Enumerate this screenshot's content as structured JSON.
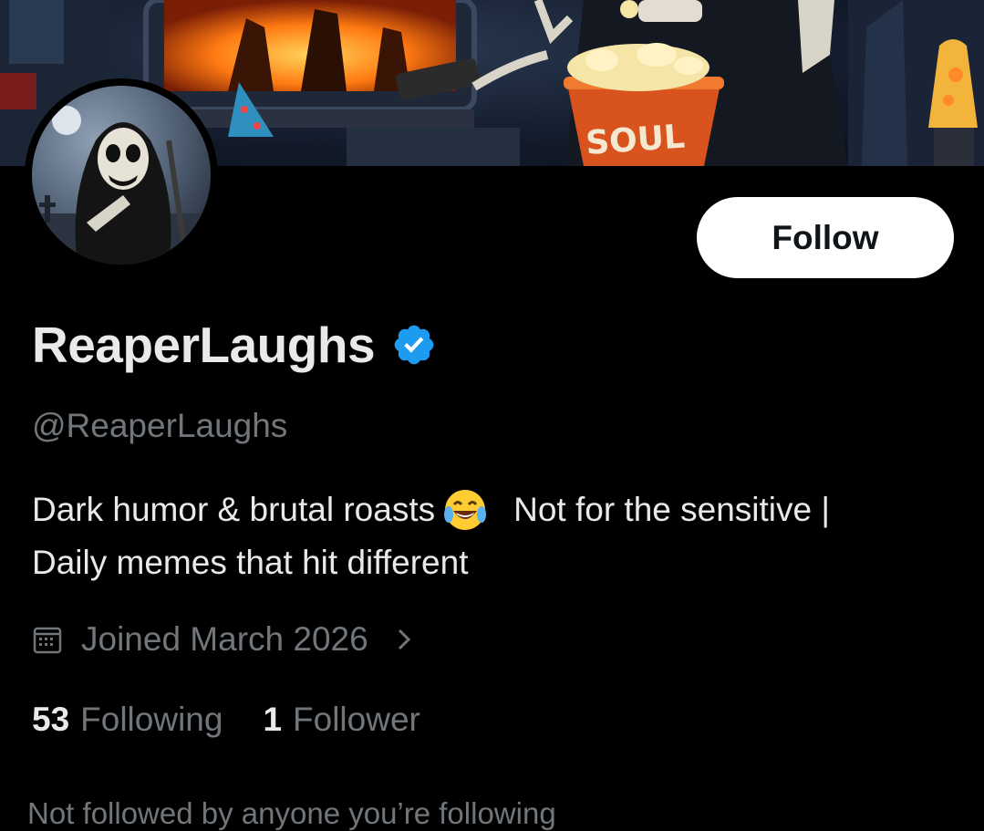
{
  "profile": {
    "display_name": "ReaperLaughs",
    "handle": "@ReaperLaughs",
    "bio_line1_a": "Dark humor & brutal roasts",
    "bio_line1_b": "Not for the sensitive |",
    "bio_line2": "Daily memes that hit different",
    "joined": "Joined March 2026",
    "following_count": "53",
    "following_label": "Following",
    "followers_count": "1",
    "followers_label": "Follower",
    "followed_by_note": "Not followed by anyone you’re following"
  },
  "banner": {
    "popcorn_text": "SOUL"
  },
  "actions": {
    "follow_label": "Follow"
  },
  "icons": {
    "verified": "verified-badge-icon",
    "emoji": "face-with-tears-of-joy-icon",
    "calendar": "calendar-icon",
    "chevron": "chevron-right-icon"
  },
  "colors": {
    "background": "#000000",
    "primary_text": "#e7e9ea",
    "secondary_text": "#71767b",
    "verified_blue": "#1d9bf0",
    "follow_button_bg": "#ffffff",
    "follow_button_text": "#0f1419"
  }
}
